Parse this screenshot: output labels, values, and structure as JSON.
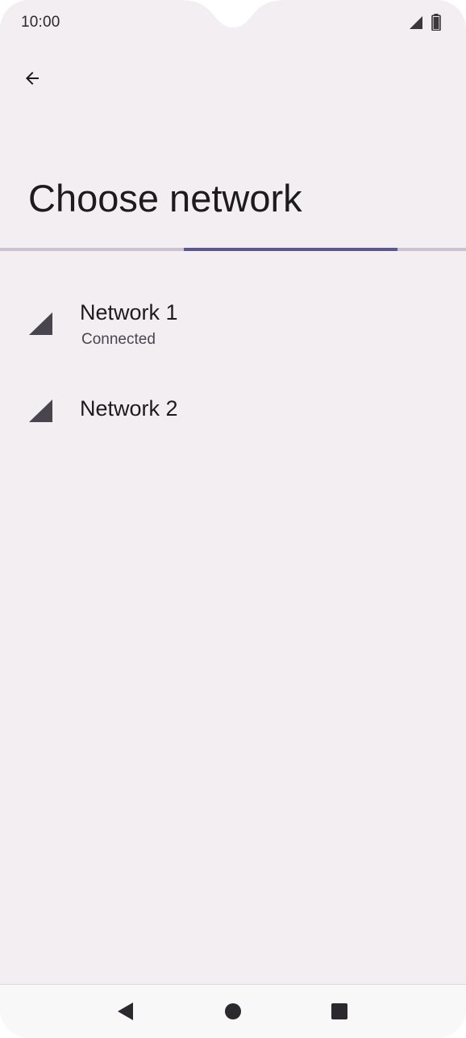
{
  "status_bar": {
    "time": "10:00",
    "signal_icon": "cell-signal-icon",
    "battery_icon": "battery-icon"
  },
  "toolbar": {
    "back_icon": "arrow-back-icon"
  },
  "page": {
    "title": "Choose network"
  },
  "progress": {
    "active_start_fraction": 0.394,
    "active_end_fraction": 0.853
  },
  "networks": [
    {
      "name": "Network 1",
      "status": "Connected",
      "icon": "signal-strength-icon"
    },
    {
      "name": "Network 2",
      "status": "",
      "icon": "signal-strength-icon"
    }
  ],
  "nav_bar": {
    "back_icon": "nav-back-icon",
    "home_icon": "nav-home-icon",
    "recents_icon": "nav-recents-icon"
  },
  "colors": {
    "background": "#f3eef2",
    "accent": "#5d578f",
    "track": "#cbc4d0",
    "icon": "#49454f"
  }
}
